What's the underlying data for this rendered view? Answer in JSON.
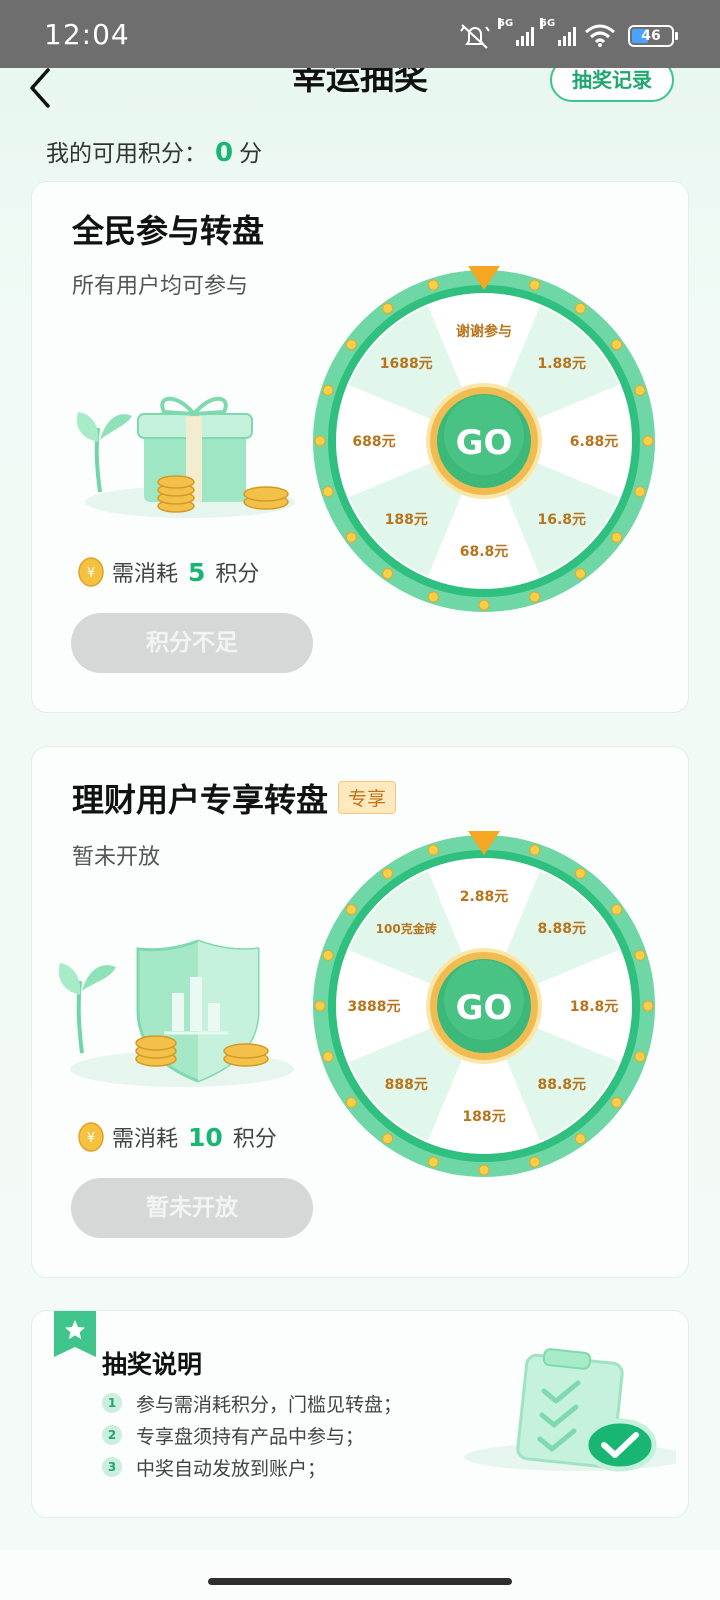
{
  "status": {
    "time": "12:04",
    "sig1": "5G",
    "sig2": "5G",
    "battery": "46"
  },
  "nav": {
    "title": "幸运抽奖",
    "record_label": "抽奖记录"
  },
  "points": {
    "label": "我的可用积分：",
    "value": "0",
    "unit": "分"
  },
  "wheel1": {
    "title": "全民参与转盘",
    "subtitle": "所有用户均可参与",
    "cost_prefix": "需消耗",
    "cost_value": "5",
    "cost_unit": "积分",
    "button_label": "积分不足",
    "go_label": "GO",
    "prizes": [
      "谢谢参与",
      "1.88元",
      "6.88元",
      "16.8元",
      "68.8元",
      "188元",
      "688元",
      "1688元"
    ]
  },
  "wheel2": {
    "title": "理财用户专享转盘",
    "tag": "专享",
    "subtitle": "暂未开放",
    "cost_prefix": "需消耗",
    "cost_value": "10",
    "cost_unit": "积分",
    "button_label": "暂未开放",
    "go_label": "GO",
    "prizes": [
      "2.88元",
      "8.88元",
      "18.8元",
      "88.8元",
      "188元",
      "888元",
      "3888元",
      "100克金砖"
    ]
  },
  "rules": {
    "title": "抽奖说明",
    "items": [
      "参与需消耗积分，门槛见转盘；",
      "专享盘须持有产品中参与；",
      "中奖自动发放到账户；"
    ]
  },
  "colors": {
    "accent": "#19b573",
    "ring": "#6fd6a5",
    "prize_text": "#b8741c",
    "button_disabled": "#d5d8d6"
  }
}
